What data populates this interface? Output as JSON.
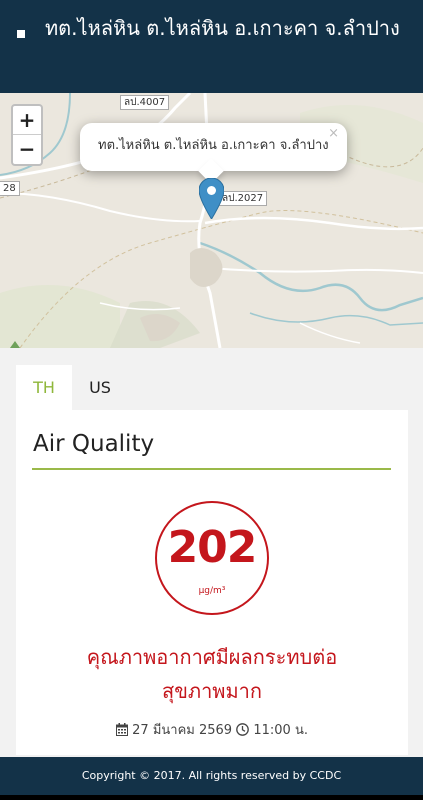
{
  "header": {
    "title": "ทต.ไหล่หิน ต.ไหล่หิน อ.เกาะคา จ.ลำปาง"
  },
  "map": {
    "zoom_in_label": "+",
    "zoom_out_label": "−",
    "popup_text": "ทต.ไหล่หิน ต.ไหล่หิน อ.เกาะคา จ.ลำปาง",
    "popup_close": "×",
    "road_labels": [
      "ลป.4007",
      "ลป.2027",
      "28"
    ],
    "marker_color": "#3f8fc6"
  },
  "tabs": [
    {
      "label": "TH",
      "active": true
    },
    {
      "label": "US",
      "active": false
    }
  ],
  "card": {
    "heading": "Air Quality",
    "aqi_value": "202",
    "aqi_unit": "µg/m³",
    "status_line1": "คุณภาพอากาศมีผลกระทบต่อ",
    "status_line2": "สุขภาพมาก",
    "date": "27 มีนาคม 2569",
    "time": "11:00 น.",
    "status_color": "#c4161c"
  },
  "footer": {
    "copyright": "Copyright © 2017. All rights reserved by CCDC"
  },
  "colors": {
    "header_bg": "#133248",
    "accent": "#9ab949",
    "tab_active": "#8fb73b"
  }
}
